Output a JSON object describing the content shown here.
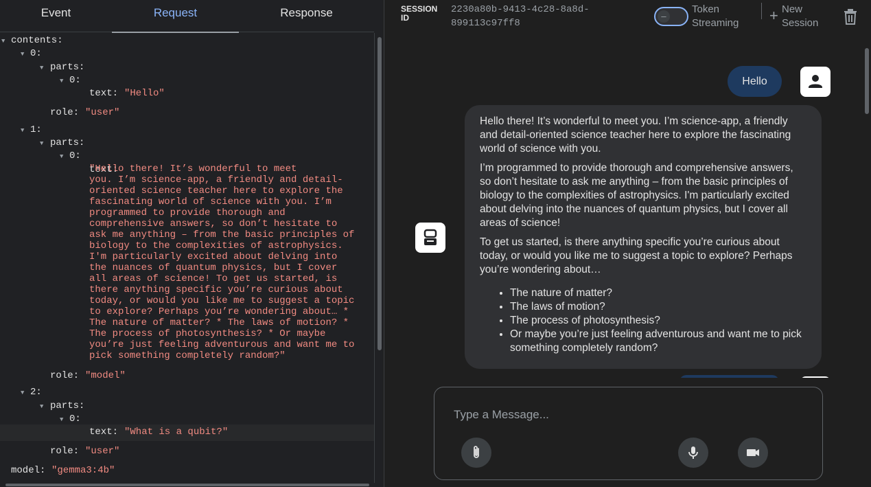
{
  "tabs": {
    "event": "Event",
    "request": "Request",
    "response": "Response"
  },
  "tree": {
    "contents_key": "contents:",
    "idx0": "0:",
    "idx1": "1:",
    "idx2": "2:",
    "parts_key": "parts:",
    "part0": "0:",
    "text_key": "text:",
    "role_key": "role:",
    "text0": "\"Hello\"",
    "role0": "\"user\"",
    "text1": "\"Hello there! It’s wonderful to meet\nyou. I’m science-app, a friendly and detail-\noriented science teacher here to explore the\nfascinating world of science with you. I’m\nprogrammed to provide thorough and\ncomprehensive answers, so don’t hesitate to\nask me anything – from the basic principles of\nbiology to the complexities of astrophysics.\nI'm particularly excited about delving into\nthe nuances of quantum physics, but I cover\nall areas of science! To get us started, is\nthere anything specific you’re curious about\ntoday, or would you like me to suggest a topic\nto explore? Perhaps you’re wondering about… *\nThe nature of matter? * The laws of motion? *\nThe process of photosynthesis? * Or maybe\nyou’re just feeling adventurous and want me to\npick something completely random?\"",
    "role1": "\"model\"",
    "text2": "\"What is a qubit?\"",
    "role2": "\"user\"",
    "model_key": "model:",
    "model_val": "\"gemma3:4b\""
  },
  "header": {
    "session_label": "SESSION ID",
    "session_id": "2230a80b-9413-4c28-8a8d-899113c97ff8",
    "token_streaming": "Token Streaming",
    "toggle_symbol": "–",
    "new_session": "New Session",
    "plus": "+"
  },
  "chat": {
    "user_message": "Hello",
    "bot_p1": "Hello there! It’s wonderful to meet you. I’m science-app, a friendly and detail-oriented science teacher here to explore the fascinating world of science with you.",
    "bot_p2": "I’m programmed to provide thorough and comprehensive answers, so don’t hesitate to ask me anything – from the basic principles of biology to the complexities of astrophysics. I'm particularly excited about delving into the nuances of quantum physics, but I cover all areas of science!",
    "bot_p3": "To get us started, is there anything specific you’re curious about today, or would you like me to suggest a topic to explore? Perhaps you’re wondering about…",
    "bullets": [
      "The nature of matter?",
      "The laws of motion?",
      "The process of photosynthesis?",
      "Or maybe you’re just feeling adventurous and want me to pick something completely random?"
    ]
  },
  "composer": {
    "placeholder": "Type a Message..."
  }
}
